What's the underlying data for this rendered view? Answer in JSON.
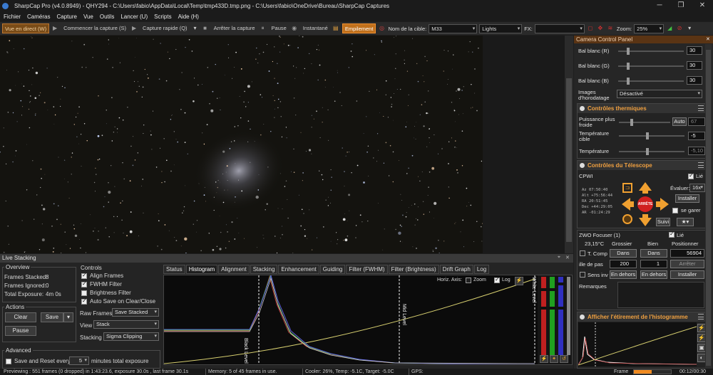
{
  "window": {
    "title": "SharpCap Pro (v4.0.8949) - QHY294 - C:\\Users\\fabio\\AppData\\Local\\Temp\\tmp433D.tmp.png - C:\\Users\\fabio\\OneDrive\\Bureau\\SharpCap Captures",
    "controls": [
      "─",
      "❐",
      "✕"
    ]
  },
  "menu": [
    "Fichier",
    "Caméras",
    "Capture",
    "Vue",
    "Outils",
    "Lancer (U)",
    "Scripts",
    "Aide (H)"
  ],
  "toolbar": {
    "live_view": "Vue en direct (W)",
    "start_capture": "Commencer la capture (S)",
    "quick_capture": "Capture rapide (Q)",
    "stop_capture": "Arrêter la capture",
    "pause": "Pause",
    "snapshot": "Instantané",
    "stack": "Empilement",
    "target_label": "Nom de la cible:",
    "target_value": "M33",
    "frame_type": "Lights",
    "fx_label": "FX:",
    "fx_value": "",
    "zoom_label": "Zoom:",
    "zoom_value": "25%"
  },
  "live_stacking": {
    "title": "Live Stacking",
    "overview": {
      "title": "Overview",
      "frames_stacked_label": "Frames Stacked:",
      "frames_stacked": "8",
      "frames_ignored_label": "Frames Ignored:",
      "frames_ignored": "0",
      "total_exposure_label": "Total Exposure:",
      "total_exposure": "4m 0s"
    },
    "actions": {
      "title": "Actions",
      "clear": "Clear",
      "save": "Save",
      "pause": "Pause"
    },
    "advanced": {
      "title": "Advanced",
      "save_reset_label": "Save and Reset every",
      "save_reset_value": "5",
      "save_reset_unit": "minutes total exposure"
    },
    "controls": {
      "title": "Controls",
      "align_frames": "Align Frames",
      "fwhm_filter": "FWHM Filter",
      "brightness_filter": "Brightness Filter",
      "auto_save": "Auto Save on Clear/Close",
      "raw_frames_label": "Raw Frames",
      "raw_frames_value": "Save Stacked",
      "view_label": "View",
      "view_value": "Stack",
      "stacking_label": "Stacking",
      "stacking_value": "Sigma Clipping"
    },
    "tabs": [
      "Status",
      "Histogram",
      "Alignment",
      "Stacking",
      "Enhancement",
      "Guiding",
      "Filter (FWHM)",
      "Filter (Brightness)",
      "Drift Graph",
      "Log"
    ],
    "selected_tab": "Histogram",
    "histogram": {
      "horiz_axis_label": "Horiz. Axis:",
      "zoom_label": "Zoom",
      "log_label": "Log",
      "black_level": "Black Level",
      "mid_level": "Mid Level",
      "white_level": "White Level"
    }
  },
  "status_bar": {
    "previewing": "Previewing : 551 frames (0 dropped) in 1:43:23.6, exposure 30.0s , last frame 30.1s",
    "memory": "Memory: 5 of 45 frames in use.",
    "cooler": "Cooler: 26%, Temp: -5.1C, Target: -5.0C",
    "gps": "GPS:",
    "frame_label": "Frame",
    "time": "00:12/00:30"
  },
  "camera_panel": {
    "title": "Camera Control Panel",
    "wb_red_label": "Bal blanc (R)",
    "wb_red": "30",
    "wb_green_label": "Bal blanc (G)",
    "wb_green": "30",
    "wb_blue_label": "Bal blanc (B)",
    "wb_blue": "30",
    "timestamp_label": "Images d'horodatage",
    "timestamp_value": "Désactivé",
    "thermal": {
      "title": "Contrôles thermiques",
      "cooler_power_label": "Puissance plus froide",
      "cooler_power_auto": "Auto",
      "cooler_power_value": "67",
      "target_temp_label": "Température cible",
      "target_temp_value": "-5",
      "temperature_label": "Température",
      "temperature_value": "-5,10"
    },
    "telescope": {
      "title": "Contrôles du Télescope",
      "mount": "CPWI",
      "linked_label": "Lié",
      "speed_label": "Évaluer:",
      "speed_value": "16x",
      "install": "Installer",
      "park_label": "se garer",
      "stop_label": "ARRÊTE",
      "follow_label": "Suivi",
      "coords": [
        {
          "k": "Az",
          "v": "07:50:40"
        },
        {
          "k": "Alt",
          "v": "+75:56:44"
        },
        {
          "k": "RA",
          "v": "20:51:45"
        },
        {
          "k": "Dec",
          "v": "+44:29:05"
        },
        {
          "k": "AR",
          "v": "-01:24:29"
        }
      ]
    },
    "focuser": {
      "title": "ZWO Focuser (1)",
      "linked_label": "Lié",
      "temperature": "23,15°C",
      "coarse_label": "Grossier",
      "fine_label": "Bien",
      "position_label": "Positionner",
      "temp_comp_label": "T. Comp",
      "in_label": "Dans",
      "position_value": "56904",
      "step_label": "ille de pas",
      "step_coarse": "200",
      "step_fine": "1",
      "stop_label": "Arrêter",
      "reverse_label": "Sens inv",
      "out_label": "En dehors",
      "install": "Installer",
      "remarks_label": "Remarques"
    },
    "stretch": {
      "title": "Afficher l'étirement de l'histogramme"
    }
  }
}
